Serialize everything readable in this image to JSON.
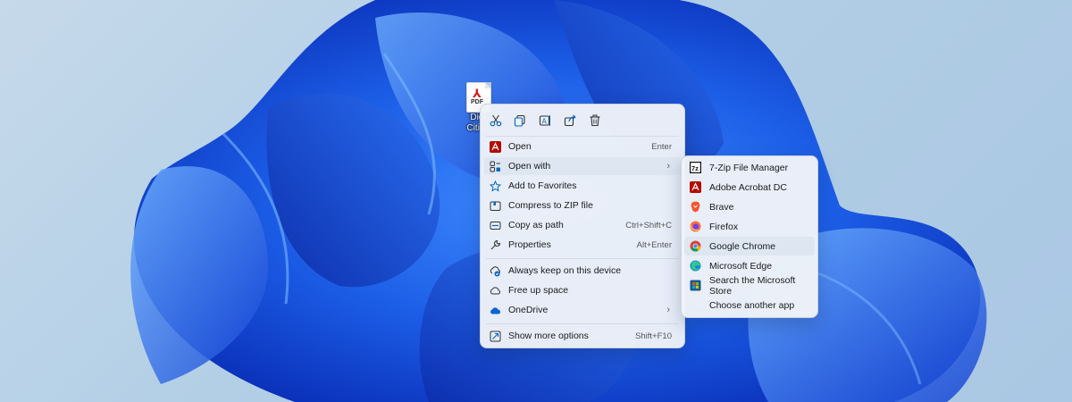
{
  "desktop": {
    "file_icon_label": "Digi\nCitize",
    "file_type_tag": "PDF"
  },
  "context_menu": {
    "toolbar": [
      {
        "name": "cut-icon"
      },
      {
        "name": "copy-icon"
      },
      {
        "name": "rename-icon"
      },
      {
        "name": "share-icon"
      },
      {
        "name": "delete-icon"
      }
    ],
    "items": [
      {
        "label": "Open",
        "shortcut": "Enter",
        "icon": "acrobat-icon"
      },
      {
        "label": "Open with",
        "shortcut": "",
        "icon": "open-with-icon",
        "submenu_arrow": "›",
        "highlighted": true
      },
      {
        "label": "Add to Favorites",
        "shortcut": "",
        "icon": "star-icon"
      },
      {
        "label": "Compress to ZIP file",
        "shortcut": "",
        "icon": "zip-icon"
      },
      {
        "label": "Copy as path",
        "shortcut": "Ctrl+Shift+C",
        "icon": "path-icon"
      },
      {
        "label": "Properties",
        "shortcut": "Alt+Enter",
        "icon": "wrench-icon"
      },
      {
        "label": "Always keep on this device",
        "shortcut": "",
        "icon": "keep-device-icon"
      },
      {
        "label": "Free up space",
        "shortcut": "",
        "icon": "cloud-outline-icon"
      },
      {
        "label": "OneDrive",
        "shortcut": "",
        "icon": "onedrive-icon",
        "submenu_arrow": "›"
      },
      {
        "label": "Show more options",
        "shortcut": "Shift+F10",
        "icon": "more-options-icon"
      }
    ]
  },
  "open_with_submenu": {
    "items": [
      {
        "label": "7-Zip File Manager",
        "icon": "7zip-icon"
      },
      {
        "label": "Adobe Acrobat DC",
        "icon": "acrobat-icon"
      },
      {
        "label": "Brave",
        "icon": "brave-icon"
      },
      {
        "label": "Firefox",
        "icon": "firefox-icon"
      },
      {
        "label": "Google Chrome",
        "icon": "chrome-icon",
        "highlighted": true
      },
      {
        "label": "Microsoft Edge",
        "icon": "edge-icon"
      },
      {
        "label": "Search the Microsoft Store",
        "icon": "store-icon"
      },
      {
        "label": "Choose another app",
        "icon": ""
      }
    ]
  },
  "colors": {
    "accent": "#0067c0",
    "acrobat_red": "#d71d20",
    "wallpaper_blue": "#1f5fe8"
  }
}
